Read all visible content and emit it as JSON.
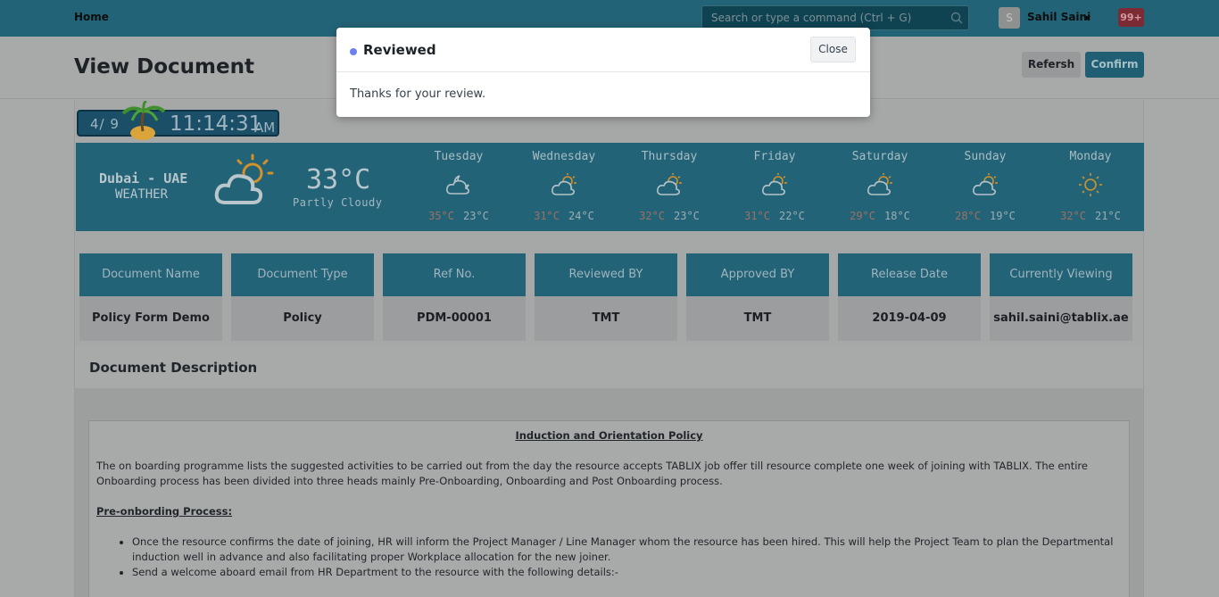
{
  "navbar": {
    "home_label": "Home",
    "search_placeholder": "Search or type a command (Ctrl + G)",
    "avatar_initial": "S",
    "user_name": "Sahil Saini",
    "notification_count": "99+"
  },
  "page": {
    "title": "View Document",
    "refresh_label": "Refersh",
    "confirm_label": "Confirm"
  },
  "clock": {
    "date": "4/ 9",
    "time": "11:14:31",
    "ampm": "AM"
  },
  "weather": {
    "city": "Dubai - UAE",
    "label": "WEATHER",
    "temperature": "33°C",
    "condition": "Partly Cloudy",
    "forecast": [
      {
        "day": "Tuesday",
        "icon": "cloud-moon-icon",
        "high": "35°C",
        "low": "23°C"
      },
      {
        "day": "Wednesday",
        "icon": "cloud-sun-icon",
        "high": "31°C",
        "low": "24°C"
      },
      {
        "day": "Thursday",
        "icon": "cloud-sun-icon",
        "high": "32°C",
        "low": "23°C"
      },
      {
        "day": "Friday",
        "icon": "cloud-sun-icon",
        "high": "31°C",
        "low": "22°C"
      },
      {
        "day": "Saturday",
        "icon": "cloud-sun-icon",
        "high": "29°C",
        "low": "18°C"
      },
      {
        "day": "Sunday",
        "icon": "cloud-sun-icon",
        "high": "28°C",
        "low": "19°C"
      },
      {
        "day": "Monday",
        "icon": "sun-icon",
        "high": "32°C",
        "low": "21°C"
      }
    ]
  },
  "document": {
    "columns": [
      {
        "header": "Document Name",
        "value": "Policy Form Demo"
      },
      {
        "header": "Document Type",
        "value": "Policy"
      },
      {
        "header": "Ref No.",
        "value": "PDM-00001"
      },
      {
        "header": "Reviewed BY",
        "value": "TMT"
      },
      {
        "header": "Approved BY",
        "value": "TMT"
      },
      {
        "header": "Release Date",
        "value": "2019-04-09"
      },
      {
        "header": "Currently Viewing",
        "value": "sahil.saini@tablix.ae"
      }
    ],
    "description_title": "Document Description",
    "heading": "Induction and Orientation Policy",
    "intro": "The on boarding programme lists the suggested activities to be carried out from the day the resource accepts TABLIX job offer till resource complete one week of joining with TABLIX. The entire Onboarding process has been divided into three heads mainly Pre-Onboarding, Onboarding and Post Onboarding process.",
    "subheading": "Pre-onbording Process:",
    "bullets": [
      "Once the resource confirms the date of joining, HR will inform the Project Manager / Line Manager whom the resource has been hired. This will help the Project Team to plan the Departmental induction well in advance and also facilitating proper Workplace allocation for the new joiner.",
      "Send a welcome aboard email from HR Department to the resource with the following details:-"
    ]
  },
  "modal": {
    "title": "Reviewed",
    "close_label": "Close",
    "message": "Thanks for your review."
  },
  "colors": {
    "navbar": "#236377",
    "weather_panel": "#236377",
    "modal_dot": "#6e7ff0",
    "notification_badge": "#7c2a33"
  }
}
